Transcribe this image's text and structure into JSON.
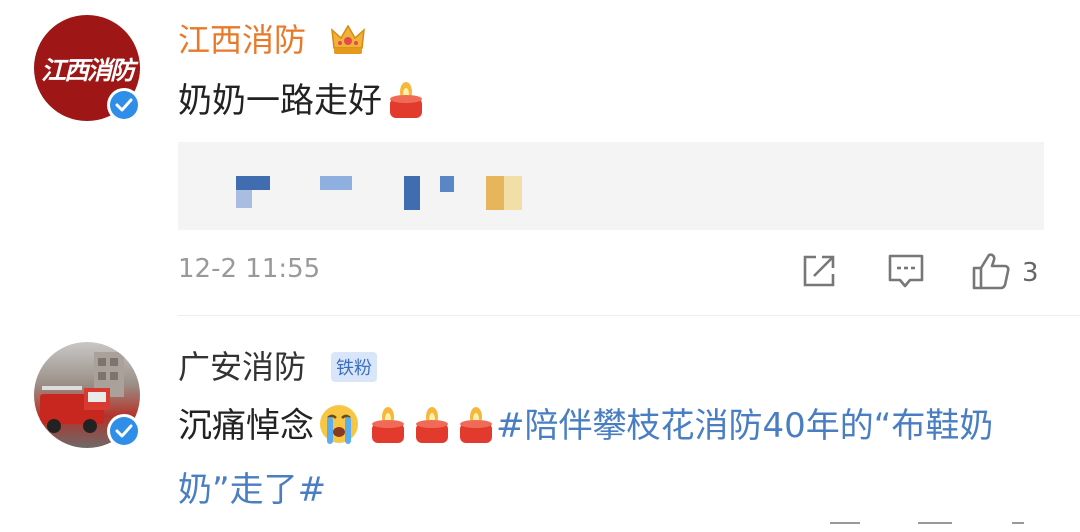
{
  "comments": [
    {
      "username": "江西消防",
      "avatar_text": "江西消防",
      "avatar_bg": "#9e1616",
      "name_color": "#e8792a",
      "has_crown": true,
      "verified": true,
      "text": "奶奶一路走好",
      "emojis": [
        "candle-emoji"
      ],
      "timestamp": "12-2 11:55",
      "likes": "3"
    },
    {
      "username": "广安消防",
      "fan_badge": "铁粉",
      "verified": true,
      "text": "沉痛悼念",
      "emojis": [
        "crying-face-emoji",
        "candle-emoji",
        "candle-emoji",
        "candle-emoji"
      ],
      "hashtag": "#陪伴攀枝花消防40年的“布鞋奶奶”走了#"
    }
  ],
  "colors": {
    "link": "#4a7ec3",
    "verified": "#2f8ee8",
    "username_vip": "#e8792a",
    "secondary_text": "#999999"
  }
}
